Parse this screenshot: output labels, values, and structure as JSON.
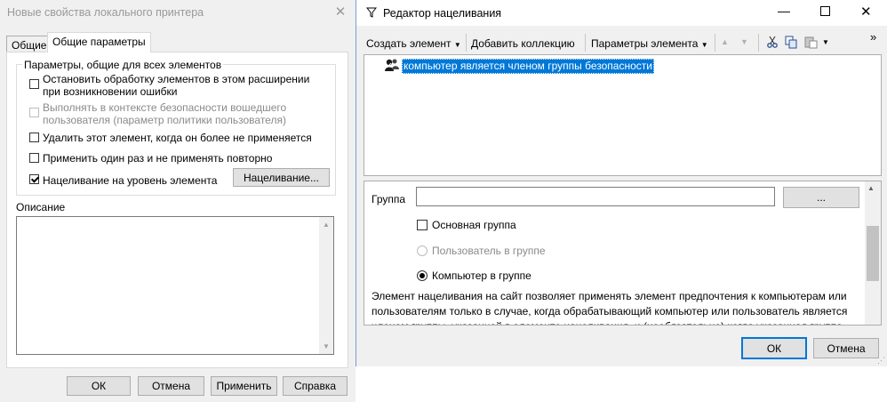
{
  "left_dialog": {
    "title": "Новые свойства локального принтера",
    "tabs": [
      "Общие",
      "Общие параметры"
    ],
    "group_title": "Параметры, общие для всех элементов",
    "options": [
      {
        "label": "Остановить обработку элементов в этом расширении при возникновении ошибки",
        "checked": false,
        "enabled": true
      },
      {
        "label": "Выполнять в контексте безопасности вошедшего пользователя (параметр политики пользователя)",
        "checked": false,
        "enabled": false
      },
      {
        "label": "Удалить этот элемент, когда он более не применяется",
        "checked": false,
        "enabled": true
      },
      {
        "label": "Применить один раз и не применять повторно",
        "checked": false,
        "enabled": true
      },
      {
        "label": "Нацеливание на уровень элемента",
        "checked": true,
        "enabled": true
      }
    ],
    "targeting_button": "Нацеливание...",
    "description_label": "Описание",
    "description_value": "",
    "buttons": {
      "ok": "ОК",
      "cancel": "Отмена",
      "apply": "Применить",
      "help": "Справка"
    }
  },
  "right_dialog": {
    "title": "Редактор нацеливания",
    "toolbar": {
      "new_item": "Создать элемент",
      "add_collection": "Добавить коллекцию",
      "item_options": "Параметры элемента"
    },
    "tree_item": "компьютер является членом группы безопасности",
    "group_label": "Группа",
    "group_value": "",
    "browse_button": "...",
    "primary_group": "Основная группа",
    "radio_user": "Пользователь в группе",
    "radio_computer": "Компьютер в группе",
    "description": "Элемент нацеливания на сайт позволяет применять элемент предпочтения к компьютерам или пользователям только в случае, когда обрабатывающий компьютер или пользователь является членом группы, указанной в элементе нацеливания, и (необязательно) когда указанная группа",
    "buttons": {
      "ok": "ОК",
      "cancel": "Отмена"
    }
  }
}
